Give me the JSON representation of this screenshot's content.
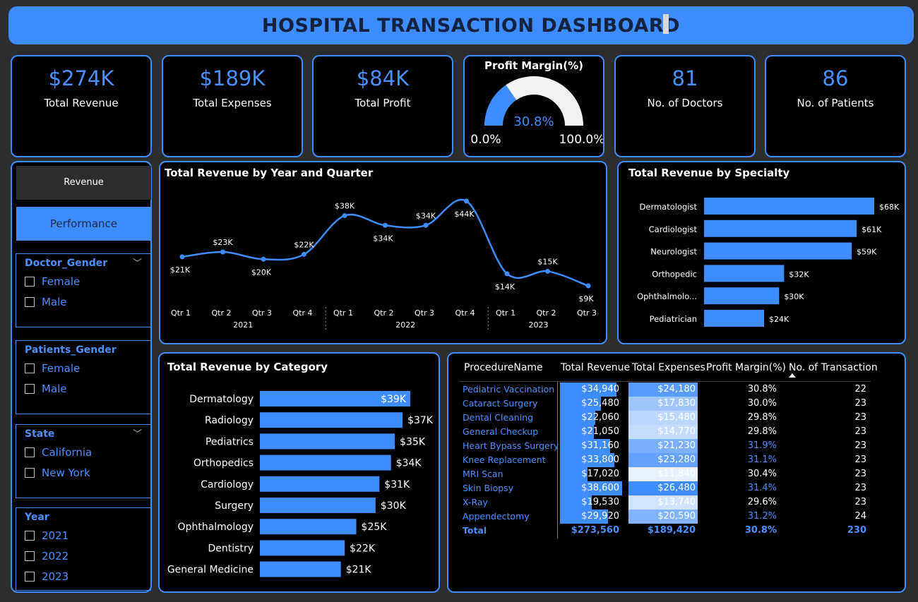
{
  "header": {
    "title": "HOSPITAL TRANSACTION DASHBOARD"
  },
  "kpis": {
    "total_revenue": {
      "value": "$274K",
      "label": "Total Revenue"
    },
    "total_expenses": {
      "value": "$189K",
      "label": "Total Expenses"
    },
    "total_profit": {
      "value": "$84K",
      "label": "Total Profit"
    },
    "doctors": {
      "value": "81",
      "label": "No. of Doctors"
    },
    "patients": {
      "value": "86",
      "label": "No. of Patients"
    }
  },
  "gauge": {
    "title": "Profit Margin(%)",
    "value": 30.8,
    "value_label": "30.8%",
    "min_label": "0.0%",
    "max_label": "100.0%",
    "fill_color": "#3f8cff",
    "track_color": "#f2f2f2"
  },
  "nav": {
    "revenue_tab": "Revenue",
    "performance_tab": "Performance"
  },
  "slicers": {
    "doctor_gender": {
      "title": "Doctor_Gender",
      "options": [
        "Female",
        "Male"
      ]
    },
    "patients_gender": {
      "title": "Patients_Gender",
      "options": [
        "Female",
        "Male"
      ]
    },
    "state": {
      "title": "State",
      "options": [
        "California",
        "New York"
      ]
    },
    "year": {
      "title": "Year",
      "options": [
        "2021",
        "2022",
        "2023"
      ]
    }
  },
  "chart_data": [
    {
      "type": "line",
      "title": "Total Revenue by Year and Quarter",
      "x": [
        "Qtr 1",
        "Qtr 2",
        "Qtr 3",
        "Qtr 4",
        "Qtr 1",
        "Qtr 2",
        "Qtr 3",
        "Qtr 4",
        "Qtr 1",
        "Qtr 2",
        "Qtr 3"
      ],
      "years": [
        {
          "label": "2021",
          "count": 4
        },
        {
          "label": "2022",
          "count": 4
        },
        {
          "label": "2023",
          "count": 3
        }
      ],
      "values": [
        21,
        23,
        20,
        22,
        38,
        34,
        34,
        44,
        14,
        15,
        9
      ],
      "labels": [
        "$21K",
        "$23K",
        "$20K",
        "$22K",
        "$38K",
        "$34K",
        "$34K",
        "$44K",
        "$14K",
        "$15K",
        "$9K"
      ],
      "units": "thousands USD",
      "color": "#3f8cff"
    },
    {
      "type": "bar",
      "orientation": "horizontal",
      "title": "Total Revenue by Specialty",
      "categories": [
        "Dermatologist",
        "Cardiologist",
        "Neurologist",
        "Orthopedic",
        "Ophthalmolo...",
        "Pediatrician"
      ],
      "values": [
        68,
        61,
        59,
        32,
        30,
        24
      ],
      "labels": [
        "$68K",
        "$61K",
        "$59K",
        "$32K",
        "$30K",
        "$24K"
      ],
      "color": "#3f8cff"
    },
    {
      "type": "bar",
      "orientation": "horizontal",
      "title": "Total Revenue by Category",
      "categories": [
        "Dermatology",
        "Radiology",
        "Pediatrics",
        "Orthopedics",
        "Cardiology",
        "Surgery",
        "Ophthalmology",
        "Dentistry",
        "General Medicine"
      ],
      "values": [
        39,
        37,
        35,
        34,
        31,
        30,
        25,
        22,
        21
      ],
      "labels": [
        "$39K",
        "$37K",
        "$35K",
        "$34K",
        "$31K",
        "$30K",
        "$25K",
        "$22K",
        "$21K"
      ],
      "color": "#3f8cff"
    },
    {
      "type": "table",
      "columns": [
        "ProcedureName",
        "Total Revenue",
        "Total Expenses",
        "Profit Margin(%)",
        "No. of Transaction"
      ],
      "sorted_column": "No. of Transaction",
      "rows": [
        {
          "name": "Pediatric Vaccination",
          "revenue": "$34,940",
          "expenses": "$24,180",
          "margin": "30.8%",
          "tx": "22",
          "rev_value": 34940,
          "exp_value": 24180,
          "margin_value": 30.8
        },
        {
          "name": "Cataract Surgery",
          "revenue": "$25,480",
          "expenses": "$17,830",
          "margin": "30.0%",
          "tx": "23",
          "rev_value": 25480,
          "exp_value": 17830,
          "margin_value": 30.0
        },
        {
          "name": "Dental Cleaning",
          "revenue": "$22,060",
          "expenses": "$15,480",
          "margin": "29.8%",
          "tx": "23",
          "rev_value": 22060,
          "exp_value": 15480,
          "margin_value": 29.8
        },
        {
          "name": "General Checkup",
          "revenue": "$21,050",
          "expenses": "$14,770",
          "margin": "29.8%",
          "tx": "23",
          "rev_value": 21050,
          "exp_value": 14770,
          "margin_value": 29.8
        },
        {
          "name": "Heart Bypass Surgery",
          "revenue": "$31,160",
          "expenses": "$21,230",
          "margin": "31.9%",
          "tx": "23",
          "rev_value": 31160,
          "exp_value": 21230,
          "margin_value": 31.9
        },
        {
          "name": "Knee Replacement",
          "revenue": "$33,800",
          "expenses": "$23,280",
          "margin": "31.1%",
          "tx": "23",
          "rev_value": 33800,
          "exp_value": 23280,
          "margin_value": 31.1
        },
        {
          "name": "MRI Scan",
          "revenue": "$17,020",
          "expenses": "$11,840",
          "margin": "30.4%",
          "tx": "23",
          "rev_value": 17020,
          "exp_value": 11840,
          "margin_value": 30.4
        },
        {
          "name": "Skin Biopsy",
          "revenue": "$38,600",
          "expenses": "$26,480",
          "margin": "31.4%",
          "tx": "23",
          "rev_value": 38600,
          "exp_value": 26480,
          "margin_value": 31.4
        },
        {
          "name": "X-Ray",
          "revenue": "$19,530",
          "expenses": "$13,740",
          "margin": "29.6%",
          "tx": "23",
          "rev_value": 19530,
          "exp_value": 13740,
          "margin_value": 29.6
        },
        {
          "name": "Appendectomy",
          "revenue": "$29,920",
          "expenses": "$20,590",
          "margin": "31.2%",
          "tx": "24",
          "rev_value": 29920,
          "exp_value": 20590,
          "margin_value": 31.2
        }
      ],
      "total": {
        "name": "Total",
        "revenue": "$273,560",
        "expenses": "$189,420",
        "margin": "30.8%",
        "tx": "230"
      }
    }
  ],
  "colors": {
    "accent": "#3f8cff",
    "background": "#000000",
    "page": "#2b2d2f"
  }
}
